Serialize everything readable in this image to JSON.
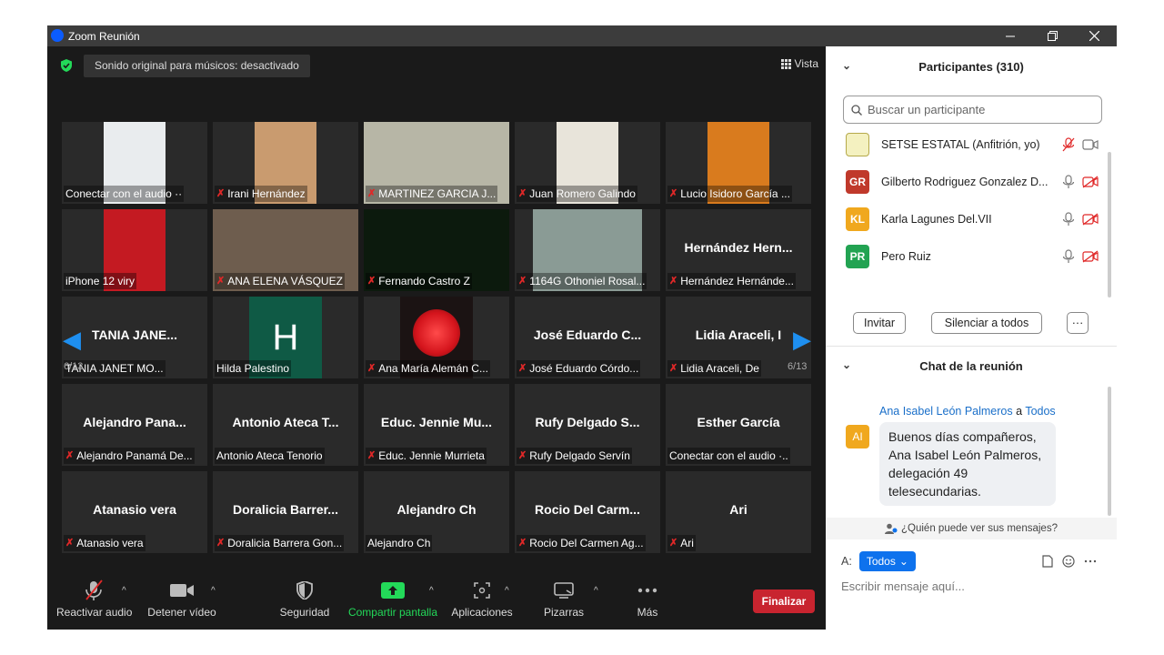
{
  "window": {
    "title": "Zoom Reunión"
  },
  "stage": {
    "audio_pill": "Sonido original para músicos: desactivado",
    "view_label": "Vista",
    "page_left": "6/13",
    "page_right": "6/13"
  },
  "tiles": [
    {
      "big": "",
      "label": "Conectar con el audio ··",
      "muted": false
    },
    {
      "big": "",
      "label": "Irani Hernández",
      "muted": true
    },
    {
      "big": "",
      "label": "MARTINEZ GARCIA J...",
      "muted": true
    },
    {
      "big": "",
      "label": "Juan Romero Galindo",
      "muted": true
    },
    {
      "big": "",
      "label": "Lucio Isidoro García ...",
      "muted": true
    },
    {
      "big": "",
      "label": "iPhone 12 viry",
      "muted": false
    },
    {
      "big": "",
      "label": "ANA ELENA VÁSQUEZ",
      "muted": true
    },
    {
      "big": "",
      "label": "Fernando Castro Z",
      "muted": true
    },
    {
      "big": "",
      "label": "1164G Othoniel Rosal...",
      "muted": true
    },
    {
      "big": "Hernández Hern...",
      "label": "Hernández Hernánde...",
      "muted": true
    },
    {
      "big": "TANIA JANE...",
      "label": "TANIA JANET MO...",
      "muted": false
    },
    {
      "big": "",
      "label": "Hilda Palestino",
      "muted": false,
      "initial": "H"
    },
    {
      "big": "",
      "label": "Ana María Alemán C...",
      "muted": true
    },
    {
      "big": "José Eduardo C...",
      "label": "José Eduardo Córdo...",
      "muted": true
    },
    {
      "big": "Lidia Araceli, I",
      "label": "Lidia Araceli, De",
      "muted": true
    },
    {
      "big": "Alejandro Pana...",
      "label": "Alejandro Panamá De...",
      "muted": true
    },
    {
      "big": "Antonio Ateca T...",
      "label": "Antonio Ateca Tenorio",
      "muted": false
    },
    {
      "big": "Educ. Jennie Mu...",
      "label": "Educ. Jennie Murrieta",
      "muted": true
    },
    {
      "big": "Rufy Delgado S...",
      "label": "Rufy Delgado Servín",
      "muted": true
    },
    {
      "big": "Esther García",
      "label": "Conectar con el audio ·..",
      "muted": false
    },
    {
      "big": "Atanasio vera",
      "label": "Atanasio vera",
      "muted": true
    },
    {
      "big": "Doralicia Barrer...",
      "label": "Doralicia Barrera Gon...",
      "muted": true
    },
    {
      "big": "Alejandro Ch",
      "label": "Alejandro Ch",
      "muted": false
    },
    {
      "big": "Rocio Del Carm...",
      "label": "Rocio Del Carmen Ag...",
      "muted": true
    },
    {
      "big": "Ari",
      "label": "Ari",
      "muted": true
    }
  ],
  "toolbar": {
    "unmute": "Reactivar audio",
    "video": "Detener vídeo",
    "security": "Seguridad",
    "share": "Compartir pantalla",
    "apps": "Aplicaciones",
    "whiteboards": "Pizarras",
    "more": "Más",
    "end": "Finalizar"
  },
  "participants": {
    "header": "Participantes (310)",
    "search_placeholder": "Buscar un participante",
    "list": [
      {
        "initials": "",
        "name": "SETSE ESTATAL (Anfitrión, yo)",
        "color": "#f4f1c0"
      },
      {
        "initials": "GR",
        "name": "Gilberto Rodriguez Gonzalez D...",
        "color": "#c0392b"
      },
      {
        "initials": "KL",
        "name": "Karla Lagunes Del.VII",
        "color": "#f0a81e"
      },
      {
        "initials": "PR",
        "name": "Pero Ruiz",
        "color": "#22a352"
      }
    ],
    "invite": "Invitar",
    "mute_all": "Silenciar a todos",
    "more": "···"
  },
  "chat": {
    "header": "Chat de la reunión",
    "sender": "Ana Isabel León Palmeros",
    "to_word": "a",
    "to_target": "Todos",
    "avatar": "AI",
    "message": "Buenos días compañeros, Ana Isabel León Palmeros, delegación 49 telesecundarias.",
    "who_sees": "¿Quién puede ver sus mensajes?",
    "to_label": "A:",
    "to_button": "Todos",
    "input_placeholder": "Escribir mensaje aquí..."
  }
}
